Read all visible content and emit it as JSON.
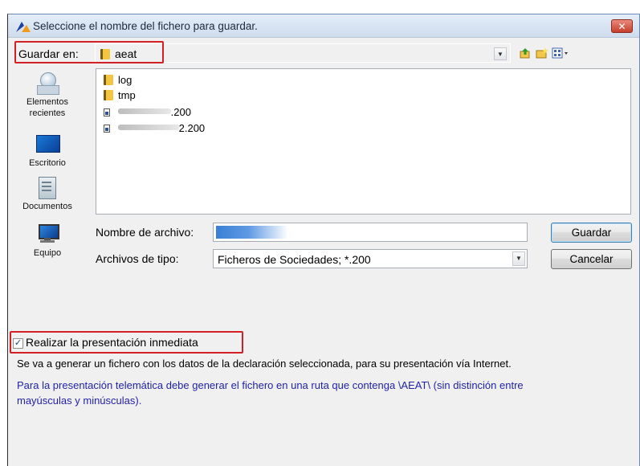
{
  "window": {
    "title": "Seleccione el nombre del fichero para guardar.",
    "close_glyph": "✕"
  },
  "location": {
    "label": "Guardar en:",
    "value": "aeat"
  },
  "toolbar_icons": [
    "up-folder-icon",
    "new-folder-icon",
    "view-menu-icon"
  ],
  "places": [
    {
      "label_line1": "Elementos",
      "label_line2": "recientes",
      "icon": "recent-items-icon"
    },
    {
      "label_line1": "Escritorio",
      "label_line2": "",
      "icon": "desktop-icon"
    },
    {
      "label_line1": "Documentos",
      "label_line2": "",
      "icon": "documents-icon"
    },
    {
      "label_line1": "Equipo",
      "label_line2": "",
      "icon": "computer-icon"
    }
  ],
  "files": [
    {
      "name": "log",
      "type": "folder"
    },
    {
      "name": "tmp",
      "type": "folder"
    },
    {
      "name": ".200",
      "type": "file"
    },
    {
      "name": "2.200",
      "type": "file"
    }
  ],
  "filename": {
    "label": "Nombre de archivo:",
    "value": ""
  },
  "filetype": {
    "label": "Archivos de tipo:",
    "value": "Ficheros de Sociedades; *.200"
  },
  "buttons": {
    "save": "Guardar",
    "cancel": "Cancelar"
  },
  "checkbox": {
    "label": "Realizar la presentación inmediata",
    "checked": true,
    "mark": "✓"
  },
  "info": {
    "line1": "Se va a generar un fichero con los datos de la declaración seleccionada, para su presentación vía Internet.",
    "line2": "Para la presentación telemática debe generar el fichero en una ruta que contenga \\AEAT\\  (sin distinción entre",
    "line3": "mayúsculas y minúsculas)."
  },
  "colors": {
    "highlight": "#d32027",
    "info_blue": "#2323a8"
  }
}
